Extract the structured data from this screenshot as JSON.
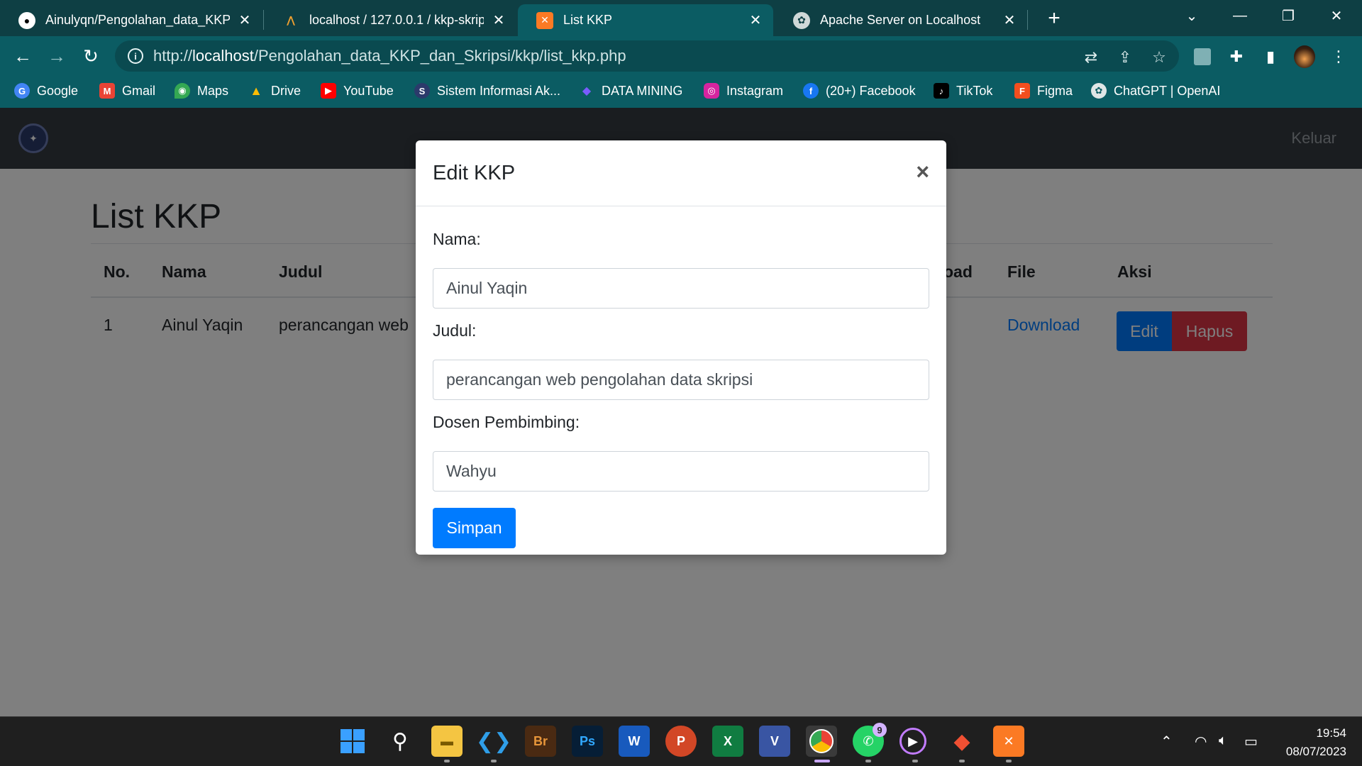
{
  "browser": {
    "tabs": [
      {
        "label": "Ainulyqn/Pengolahan_data_KKP_",
        "icon": "github-icon"
      },
      {
        "label": "localhost / 127.0.0.1 / kkp-skripsi",
        "icon": "phpmyadmin-icon"
      },
      {
        "label": "List KKP",
        "icon": "xampp-icon",
        "active": true
      },
      {
        "label": "Apache Server on Localhost",
        "icon": "chatgpt-icon"
      }
    ],
    "close_glyph": "✕",
    "url_scheme": "http://",
    "url_host": "localhost",
    "url_path": "/Pengolahan_data_KKP_dan_Skripsi/kkp/list_kkp.php",
    "bookmarks": [
      {
        "label": "Google",
        "color": "#4285f4",
        "glyph": "G"
      },
      {
        "label": "Gmail",
        "color": "#ea4335",
        "glyph": "M"
      },
      {
        "label": "Maps",
        "color": "#34a853",
        "glyph": "◉"
      },
      {
        "label": "Drive",
        "color": "#fbbc04",
        "glyph": "▲"
      },
      {
        "label": "YouTube",
        "color": "#ff0000",
        "glyph": "▶"
      },
      {
        "label": "Sistem Informasi Ak...",
        "color": "#2b3a6b",
        "glyph": "S"
      },
      {
        "label": "DATA MINING",
        "color": "#5b3fd1",
        "glyph": "◆"
      },
      {
        "label": "Instagram",
        "color": "#d6249f",
        "glyph": "◎"
      },
      {
        "label": "(20+) Facebook",
        "color": "#1877f2",
        "glyph": "f"
      },
      {
        "label": "TikTok",
        "color": "#000000",
        "glyph": "♪"
      },
      {
        "label": "Figma",
        "color": "#f24e1e",
        "glyph": "F"
      },
      {
        "label": "ChatGPT | OpenAI",
        "color": "#10a37f",
        "glyph": "✿"
      }
    ]
  },
  "site": {
    "logout_label": "Keluar",
    "page_title": "List KKP",
    "table": {
      "headers": [
        "No.",
        "Nama",
        "Judul",
        "...oad",
        "File",
        "Aksi"
      ],
      "header_visible": {
        "no": "No.",
        "nama": "Nama",
        "judul": "Judul",
        "partial": "oad",
        "file": "File",
        "aksi": "Aksi"
      },
      "rows": [
        {
          "no": "1",
          "nama": "Ainul Yaqin",
          "judul": "perancangan web",
          "file": "Download",
          "edit": "Edit",
          "hapus": "Hapus"
        }
      ]
    }
  },
  "modal": {
    "title": "Edit KKP",
    "close_glyph": "×",
    "fields": {
      "nama": {
        "label": "Nama:",
        "value": "Ainul Yaqin"
      },
      "judul": {
        "label": "Judul:",
        "value": "perancangan web pengolahan data skripsi"
      },
      "dosen": {
        "label": "Dosen Pembimbing:",
        "value": "Wahyu"
      }
    },
    "submit_label": "Simpan"
  },
  "taskbar": {
    "time": "19:54",
    "date": "08/07/2023",
    "whatsapp_badge": "9",
    "apps": [
      "start",
      "search",
      "file-explorer",
      "vscode",
      "bridge",
      "photoshop",
      "word",
      "powerpoint",
      "excel",
      "visio",
      "chrome",
      "whatsapp",
      "media-player",
      "git",
      "xampp"
    ]
  },
  "colors": {
    "chrome_tabbar": "#0e3f44",
    "chrome_toolbar": "#0b5c63",
    "primary": "#007bff",
    "danger": "#dc3545",
    "navbar": "#343a40"
  }
}
